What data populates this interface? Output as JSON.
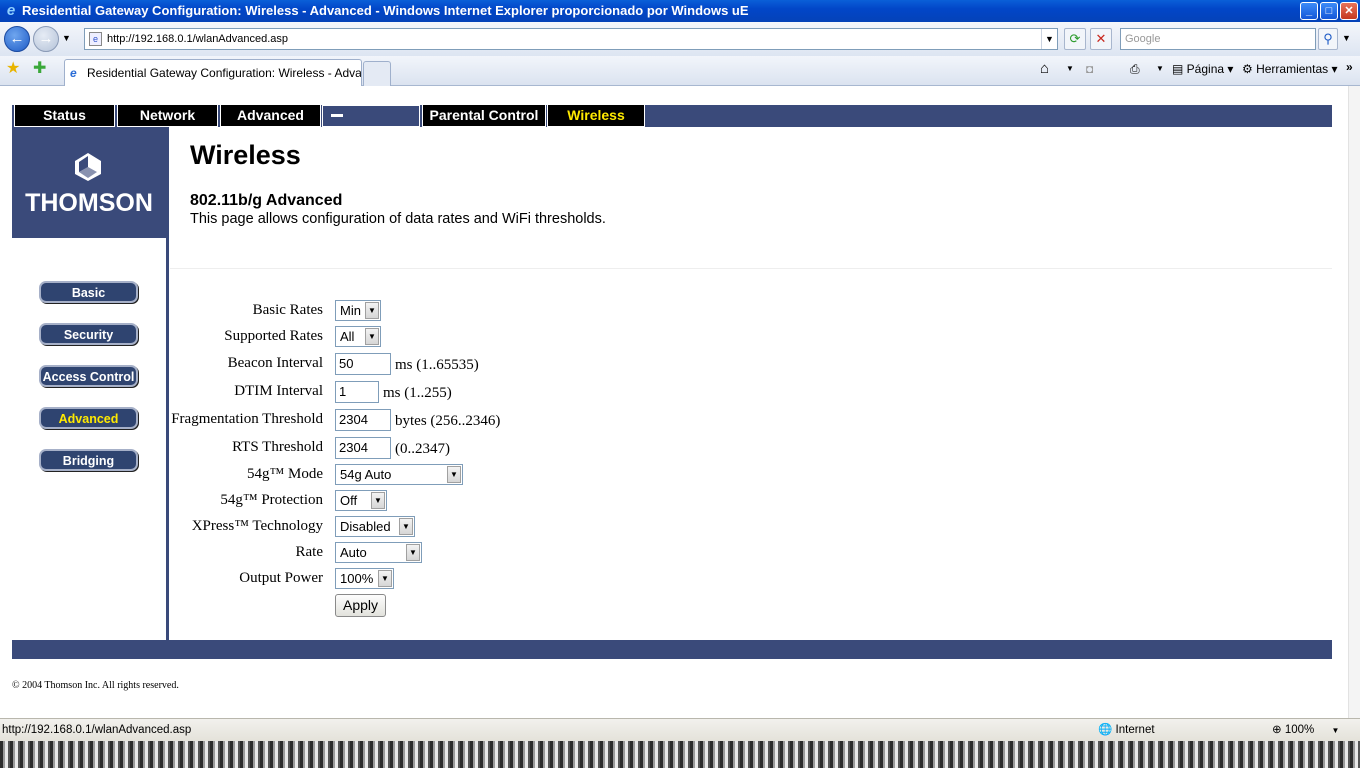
{
  "window": {
    "title": "Residential Gateway Configuration: Wireless - Advanced - Windows Internet Explorer proporcionado por Windows uE"
  },
  "browser": {
    "address": "http://192.168.0.1/wlanAdvanced.asp",
    "search_placeholder": "Google",
    "tab_title": "Residential Gateway Configuration: Wireless - Advanced",
    "cmd_page": "Página",
    "cmd_tools": "Herramientas",
    "status_url": "http://192.168.0.1/wlanAdvanced.asp",
    "zone": "Internet",
    "zoom": "100%"
  },
  "topnav": [
    "Status",
    "Network",
    "Advanced",
    "Parental Control",
    "Wireless"
  ],
  "logo": {
    "brand": "THOMSON"
  },
  "sidebar": [
    {
      "label": "Basic",
      "active": false
    },
    {
      "label": "Security",
      "active": false
    },
    {
      "label": "Access Control",
      "active": false
    },
    {
      "label": "Advanced",
      "active": true
    },
    {
      "label": "Bridging",
      "active": false
    }
  ],
  "main": {
    "title": "Wireless",
    "subtitle": "802.11b/g Advanced",
    "description": "This page allows configuration of data rates and WiFi thresholds."
  },
  "form": {
    "basic_rates": {
      "label": "Basic Rates",
      "value": "Min"
    },
    "supported_rates": {
      "label": "Supported Rates",
      "value": "All"
    },
    "beacon_interval": {
      "label": "Beacon Interval",
      "value": "50",
      "unit": "ms (1..65535)"
    },
    "dtim_interval": {
      "label": "DTIM Interval",
      "value": "1",
      "unit": "ms (1..255)"
    },
    "frag_threshold": {
      "label": "Fragmentation Threshold",
      "value": "2304",
      "unit": "bytes (256..2346)"
    },
    "rts_threshold": {
      "label": "RTS Threshold",
      "value": "2304",
      "unit": "(0..2347)"
    },
    "mode_54g": {
      "label": "54g™ Mode",
      "value": "54g Auto"
    },
    "protection_54g": {
      "label": "54g™ Protection",
      "value": "Off"
    },
    "xpress": {
      "label": "XPress™ Technology",
      "value": "Disabled"
    },
    "rate": {
      "label": "Rate",
      "value": "Auto"
    },
    "output_power": {
      "label": "Output Power",
      "value": "100%"
    },
    "apply_label": "Apply"
  },
  "footer": {
    "copyright": "© 2004 Thomson Inc.   All rights reserved."
  },
  "colors": {
    "brand_navy": "#3a4a7a",
    "active_yellow": "#ffea00",
    "titlebar_blue": "#0246c8"
  }
}
